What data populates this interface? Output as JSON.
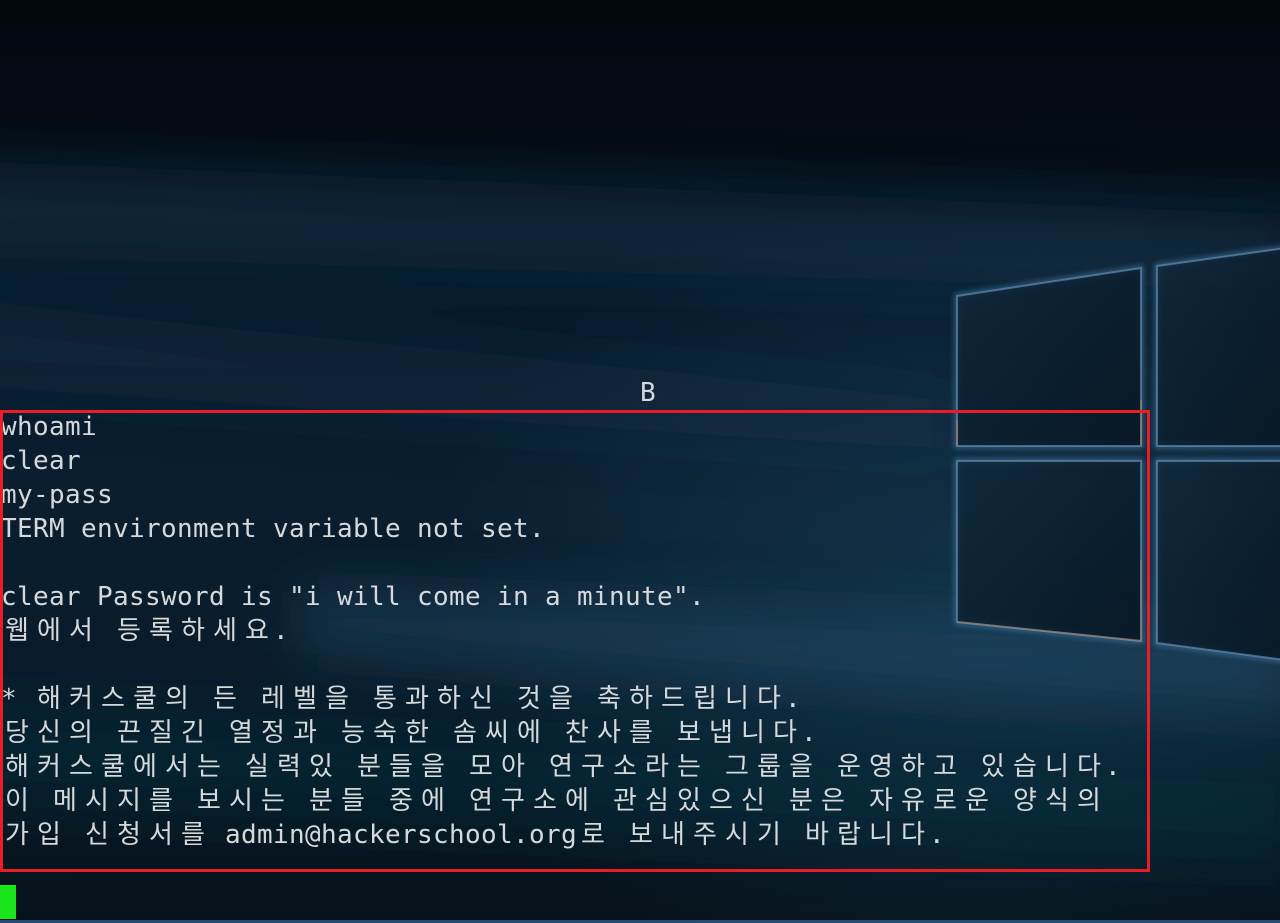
{
  "terminal": {
    "top_char": "B",
    "lines": [
      "whoami",
      "clear",
      "my-pass",
      "TERM environment variable not set.",
      "clear Password is \"i will come in a minute\".",
      "웹에서 등록하세요.",
      "* 해커스쿨의 든 레벨을 통과하신 것을 축하드립니다.",
      "당신의 끈질긴 열정과 능숙한 솜씨에 찬사를 보냅니다.",
      "해커스쿨에서는 실력있 분들을 모아 연구소라는 그룹을 운영하고 있습니다.",
      "이 메시지를 보시는 분들 중에 연구소에 관심있으신 분은 자유로운 양식의",
      "가입 신청서를 admin@hackerschool.org로 보내주시기 바랍니다."
    ]
  },
  "colors": {
    "text": "#d6d9dc",
    "highlight": "#ea1c24",
    "cursor": "#19e619",
    "background": "#06121b"
  }
}
